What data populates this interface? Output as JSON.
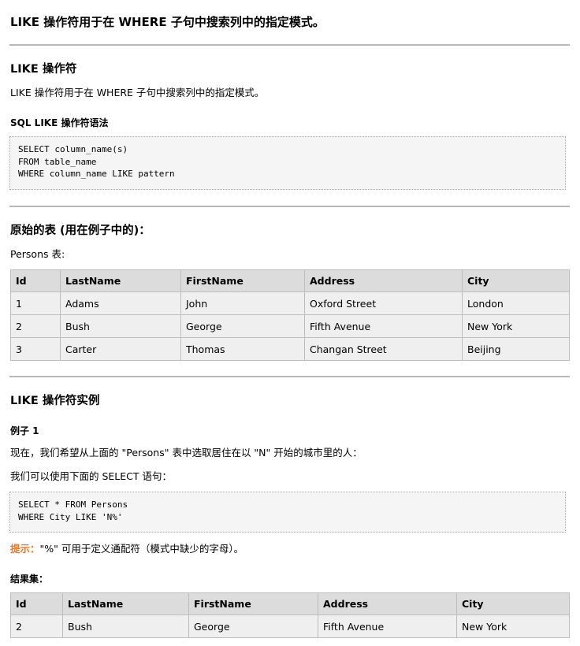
{
  "page": {
    "title": "LIKE 操作符用于在 WHERE 子句中搜索列中的指定模式。"
  },
  "section1": {
    "heading": "LIKE 操作符",
    "description": "LIKE 操作符用于在 WHERE 子句中搜索列中的指定模式。",
    "syntax_heading": "SQL LIKE 操作符语法",
    "syntax_code": "SELECT column_name(s)\nFROM table_name\nWHERE column_name LIKE pattern"
  },
  "section2": {
    "heading": "原始的表 (用在例子中的)：",
    "table_caption": "Persons 表:",
    "table": {
      "headers": [
        "Id",
        "LastName",
        "FirstName",
        "Address",
        "City"
      ],
      "rows": [
        [
          "1",
          "Adams",
          "John",
          "Oxford Street",
          "London"
        ],
        [
          "2",
          "Bush",
          "George",
          "Fifth Avenue",
          "New York"
        ],
        [
          "3",
          "Carter",
          "Thomas",
          "Changan Street",
          "Beijing"
        ]
      ]
    }
  },
  "section3": {
    "heading": "LIKE 操作符实例",
    "example_heading": "例子 1",
    "example_intro": "现在，我们希望从上面的 \"Persons\" 表中选取居住在以 \"N\" 开始的城市里的人：",
    "example_lead": "我们可以使用下面的 SELECT 语句：",
    "example_code": "SELECT * FROM Persons\nWHERE City LIKE 'N%'",
    "tip_label": "提示：",
    "tip_text": "\"%\" 可用于定义通配符（模式中缺少的字母）。",
    "result_heading": "结果集：",
    "result_table": {
      "headers": [
        "Id",
        "LastName",
        "FirstName",
        "Address",
        "City"
      ],
      "rows": [
        [
          "2",
          "Bush",
          "George",
          "Fifth Avenue",
          "New York"
        ]
      ]
    }
  }
}
